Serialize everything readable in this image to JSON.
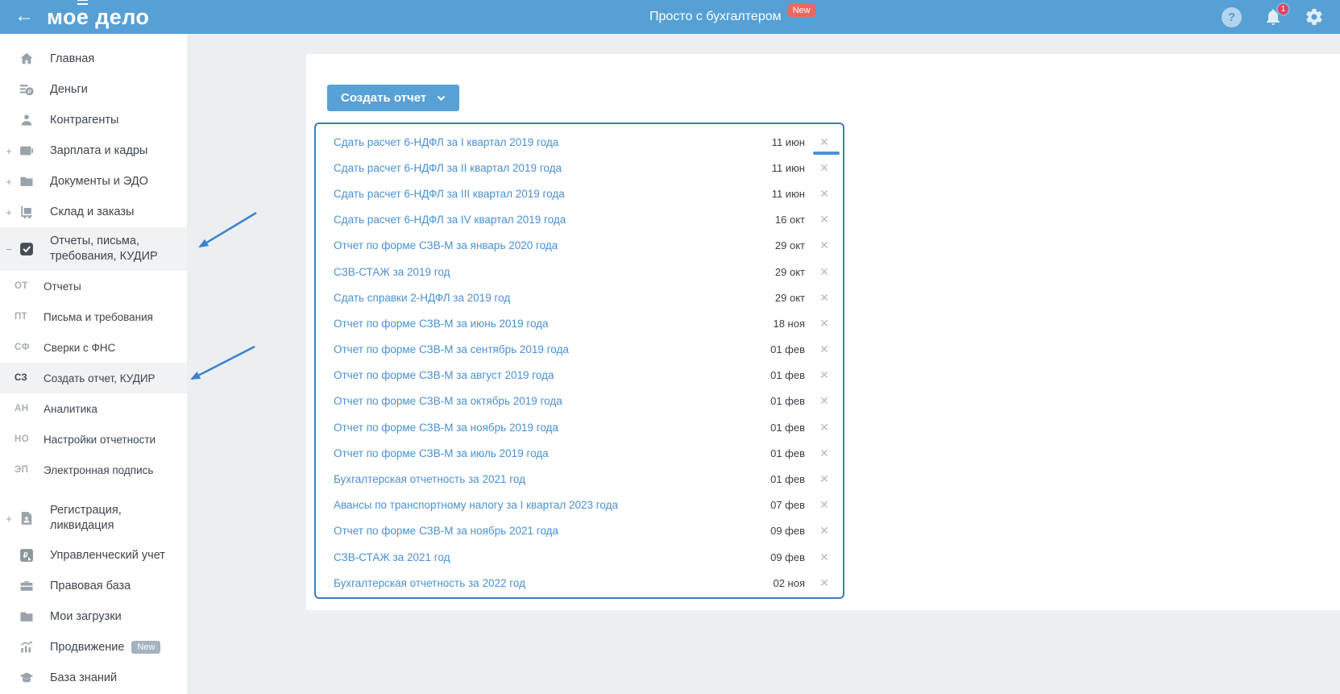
{
  "header": {
    "logo": {
      "part1": "мо",
      "part2": "е",
      "part3": " дело"
    },
    "tagline": "Просто с бухгалтером",
    "tagline_badge": "New",
    "help": "?",
    "notifications_count": "1"
  },
  "sidebar": {
    "items_top": [
      {
        "icon": "home",
        "label": "Главная"
      },
      {
        "icon": "money",
        "label": "Деньги"
      },
      {
        "icon": "contractors",
        "label": "Контрагенты"
      },
      {
        "expand": "+",
        "icon": "salary",
        "label": "Зарплата и кадры"
      },
      {
        "expand": "+",
        "icon": "documents",
        "label": "Документы и ЭДО"
      },
      {
        "expand": "+",
        "icon": "warehouse",
        "label": "Склад и заказы"
      },
      {
        "expand": "−",
        "icon": "reports",
        "label": "Отчеты, письма,\nтребования, КУДИР",
        "active": true
      }
    ],
    "submenu": [
      {
        "abbr": "ОТ",
        "label": "Отчеты"
      },
      {
        "abbr": "ПТ",
        "label": "Письма и требования"
      },
      {
        "abbr": "СФ",
        "label": "Сверки с ФНС"
      },
      {
        "abbr": "СЗ",
        "label": "Создать отчет, КУДИР",
        "active": true
      },
      {
        "abbr": "АН",
        "label": "Аналитика"
      },
      {
        "abbr": "НО",
        "label": "Настройки отчетности"
      },
      {
        "abbr": "ЭП",
        "label": "Электронная подпись"
      }
    ],
    "items_bottom": [
      {
        "expand": "+",
        "icon": "registration",
        "label": "Регистрация,\nликвидация",
        "gap": true
      },
      {
        "icon": "management",
        "label": "Управленческий учет"
      },
      {
        "icon": "legal",
        "label": "Правовая база"
      },
      {
        "icon": "downloads",
        "label": "Мои загрузки"
      },
      {
        "icon": "promotion",
        "label": "Продвижение",
        "badge": "New"
      },
      {
        "icon": "knowledge",
        "label": "База знаний"
      }
    ]
  },
  "main": {
    "create_button": {
      "label": "Создать отчет"
    },
    "close_glyph": "✕",
    "reports": [
      {
        "title": "Сдать расчет 6-НДФЛ за I квартал 2019 года",
        "date": "11 июн"
      },
      {
        "title": "Сдать расчет 6-НДФЛ за II квартал 2019 года",
        "date": "11 июн"
      },
      {
        "title": "Сдать расчет 6-НДФЛ за III квартал 2019 года",
        "date": "11 июн"
      },
      {
        "title": "Сдать расчет 6-НДФЛ за IV квартал 2019 года",
        "date": "16 окт"
      },
      {
        "title": "Отчет по форме СЗВ-М за январь 2020 года",
        "date": "29 окт"
      },
      {
        "title": "СЗВ-СТАЖ за 2019 год",
        "date": "29 окт"
      },
      {
        "title": "Сдать справки 2-НДФЛ за 2019 год",
        "date": "29 окт"
      },
      {
        "title": "Отчет по форме СЗВ-М за июнь 2019 года",
        "date": "18 ноя"
      },
      {
        "title": "Отчет по форме СЗВ-М за сентябрь 2019 года",
        "date": "01 фев"
      },
      {
        "title": "Отчет по форме СЗВ-М за август 2019 года",
        "date": "01 фев"
      },
      {
        "title": "Отчет по форме СЗВ-М за октябрь 2019 года",
        "date": "01 фев"
      },
      {
        "title": "Отчет по форме СЗВ-М за ноябрь 2019 года",
        "date": "01 фев"
      },
      {
        "title": "Отчет по форме СЗВ-М за июль 2019 года",
        "date": "01 фев"
      },
      {
        "title": "Бухгалтерская отчетность за 2021 год",
        "date": "01 фев"
      },
      {
        "title": "Авансы по транспортному налогу за I квартал 2023 года",
        "date": "07 фев"
      },
      {
        "title": "Отчет по форме СЗВ-М за ноябрь 2021 года",
        "date": "09 фев"
      },
      {
        "title": "СЗВ-СТАЖ за 2021 год",
        "date": "09 фев"
      },
      {
        "title": "Бухгалтерская отчетность за 2022 год",
        "date": "02 ноя"
      }
    ]
  },
  "colors": {
    "header_blue": "#56a0d6",
    "link_blue": "#4a90d2",
    "box_border_blue": "#3e79c6",
    "badge_red": "#ed6760",
    "annotation_arrow_blue": "#3b82d0"
  }
}
